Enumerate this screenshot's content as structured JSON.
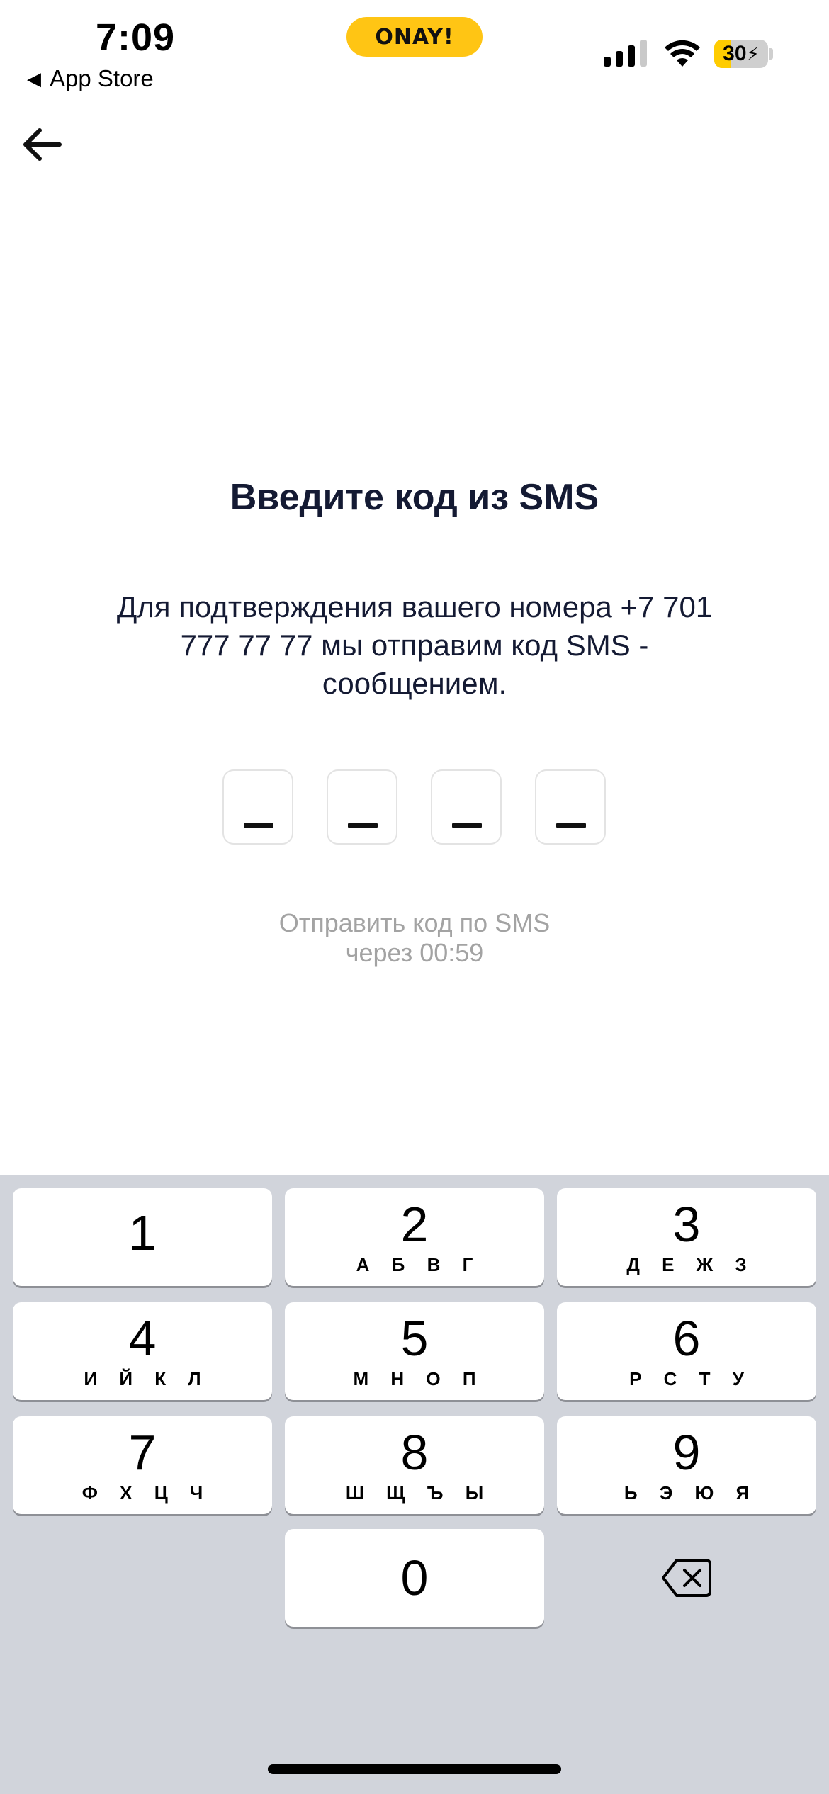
{
  "status_bar": {
    "time": "7:09",
    "back_app": "App Store",
    "pill_label": "ONAY!",
    "battery": "30",
    "accent": "#FFC514"
  },
  "screen": {
    "title": "Введите код из SMS",
    "subtitle": "Для подтверждения вашего номера +7 701 777 77 77 мы отправим код SMS - сообщением.",
    "resend_line1": "Отправить код по SMS",
    "resend_line2": "через 00:59",
    "code_length": 4
  },
  "keypad": {
    "keys": [
      {
        "num": "1",
        "letters": ""
      },
      {
        "num": "2",
        "letters": "А Б В Г"
      },
      {
        "num": "3",
        "letters": "Д Е Ж З"
      },
      {
        "num": "4",
        "letters": "И Й К Л"
      },
      {
        "num": "5",
        "letters": "М Н О П"
      },
      {
        "num": "6",
        "letters": "Р С Т У"
      },
      {
        "num": "7",
        "letters": "Ф Х Ц Ч"
      },
      {
        "num": "8",
        "letters": "Ш Щ Ъ Ы"
      },
      {
        "num": "9",
        "letters": "Ь Э Ю Я"
      },
      {
        "num": "0",
        "letters": ""
      }
    ],
    "backspace_icon": "backspace-icon"
  }
}
